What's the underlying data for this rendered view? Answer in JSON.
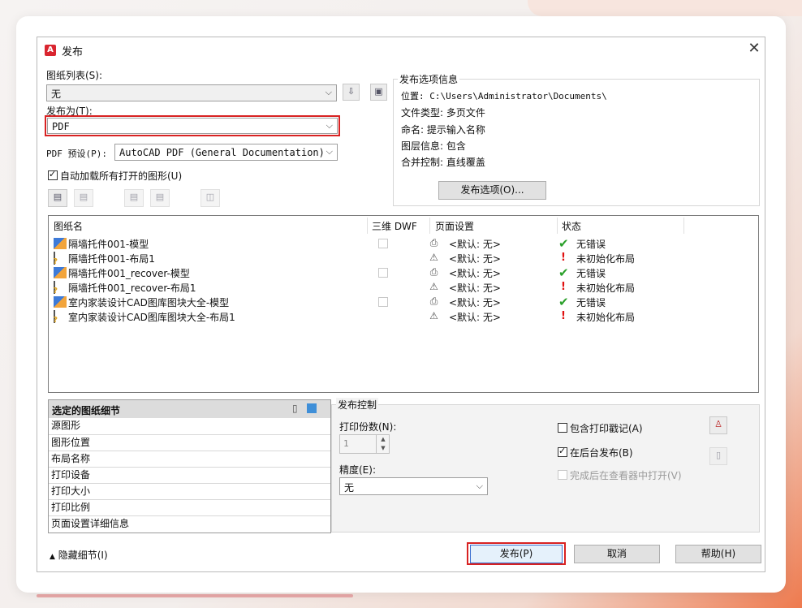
{
  "dialog": {
    "title": "发布",
    "close_glyph": "✕"
  },
  "sheet_list": {
    "label": "图纸列表(S):",
    "value": "无"
  },
  "publish_to": {
    "label": "发布为(T):",
    "value": "PDF"
  },
  "pdf_preset": {
    "label": "PDF 预设(P):",
    "value": "AutoCAD PDF (General Documentation)"
  },
  "auto_load": {
    "label": "自动加载所有打开的图形(U)",
    "checked": true
  },
  "publish_info": {
    "legend": "发布选项信息",
    "location": "位置: C:\\Users\\Administrator\\Documents\\",
    "file_type": "文件类型: 多页文件",
    "naming": "命名: 提示输入名称",
    "layer_info": "图层信息: 包含",
    "merge_control": "合并控制: 直线覆盖",
    "options_button": "发布选项(O)..."
  },
  "table": {
    "headers": [
      "图纸名",
      "三维 DWF",
      "页面设置",
      "状态"
    ],
    "rows": [
      {
        "name": "隔墙托件001-模型",
        "kind": "model",
        "page_setup": "<默认: 无>",
        "status": "无错误",
        "ok": true
      },
      {
        "name": "隔墙托件001-布局1",
        "kind": "layout",
        "page_setup": "<默认: 无>",
        "status": "未初始化布局",
        "ok": false
      },
      {
        "name": "隔墙托件001_recover-模型",
        "kind": "model",
        "page_setup": "<默认: 无>",
        "status": "无错误",
        "ok": true
      },
      {
        "name": "隔墙托件001_recover-布局1",
        "kind": "layout",
        "page_setup": "<默认: 无>",
        "status": "未初始化布局",
        "ok": false
      },
      {
        "name": "室内家装设计CAD图库图块大全-模型",
        "kind": "model",
        "page_setup": "<默认: 无>",
        "status": "无错误",
        "ok": true
      },
      {
        "name": "室内家装设计CAD图库图块大全-布局1",
        "kind": "layout",
        "page_setup": "<默认: 无>",
        "status": "未初始化布局",
        "ok": false
      }
    ]
  },
  "details": {
    "header": "选定的图纸细节",
    "items": [
      "源图形",
      "图形位置",
      "布局名称",
      "打印设备",
      "打印大小",
      "打印比例",
      "页面设置详细信息"
    ]
  },
  "publish_control": {
    "legend": "发布控制",
    "copies_label": "打印份数(N):",
    "copies_value": "1",
    "precision_label": "精度(E):",
    "precision_value": "无",
    "include_stamp": {
      "label": "包含打印戳记(A)",
      "checked": false
    },
    "background": {
      "label": "在后台发布(B)",
      "checked": true
    },
    "open_viewer": {
      "label": "完成后在查看器中打开(V)",
      "checked": false
    }
  },
  "footer": {
    "hide_details": "隐藏细节(I)",
    "publish": "发布(P)",
    "cancel": "取消",
    "help": "帮助(H)"
  },
  "colors": {
    "highlight_red": "#d82222",
    "ok_green": "#2aa02a",
    "error_red": "#e01010"
  }
}
